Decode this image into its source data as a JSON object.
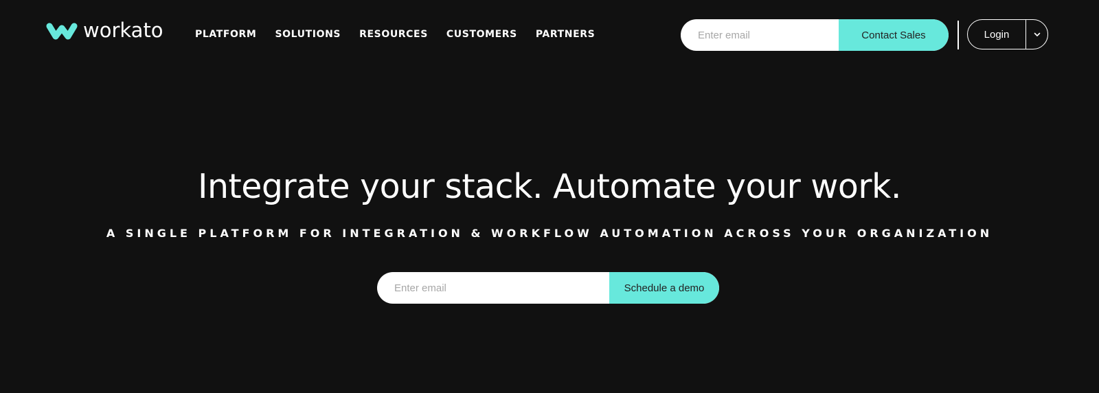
{
  "brand": {
    "name": "workato",
    "accent_color": "#67e8dc",
    "background_color": "#111111"
  },
  "nav": {
    "items": [
      {
        "label": "PLATFORM"
      },
      {
        "label": "SOLUTIONS"
      },
      {
        "label": "RESOURCES"
      },
      {
        "label": "CUSTOMERS"
      },
      {
        "label": "PARTNERS"
      }
    ]
  },
  "header_form": {
    "email_placeholder": "Enter email",
    "email_value": "",
    "submit_label": "Contact Sales"
  },
  "login": {
    "label": "Login",
    "dropdown_icon": "chevron-down-icon"
  },
  "hero": {
    "title": "Integrate your stack. Automate your work.",
    "subtitle": "A SINGLE PLATFORM FOR INTEGRATION & WORKFLOW AUTOMATION ACROSS YOUR ORGANIZATION",
    "email_placeholder": "Enter email",
    "email_value": "",
    "cta_label": "Schedule a demo"
  }
}
